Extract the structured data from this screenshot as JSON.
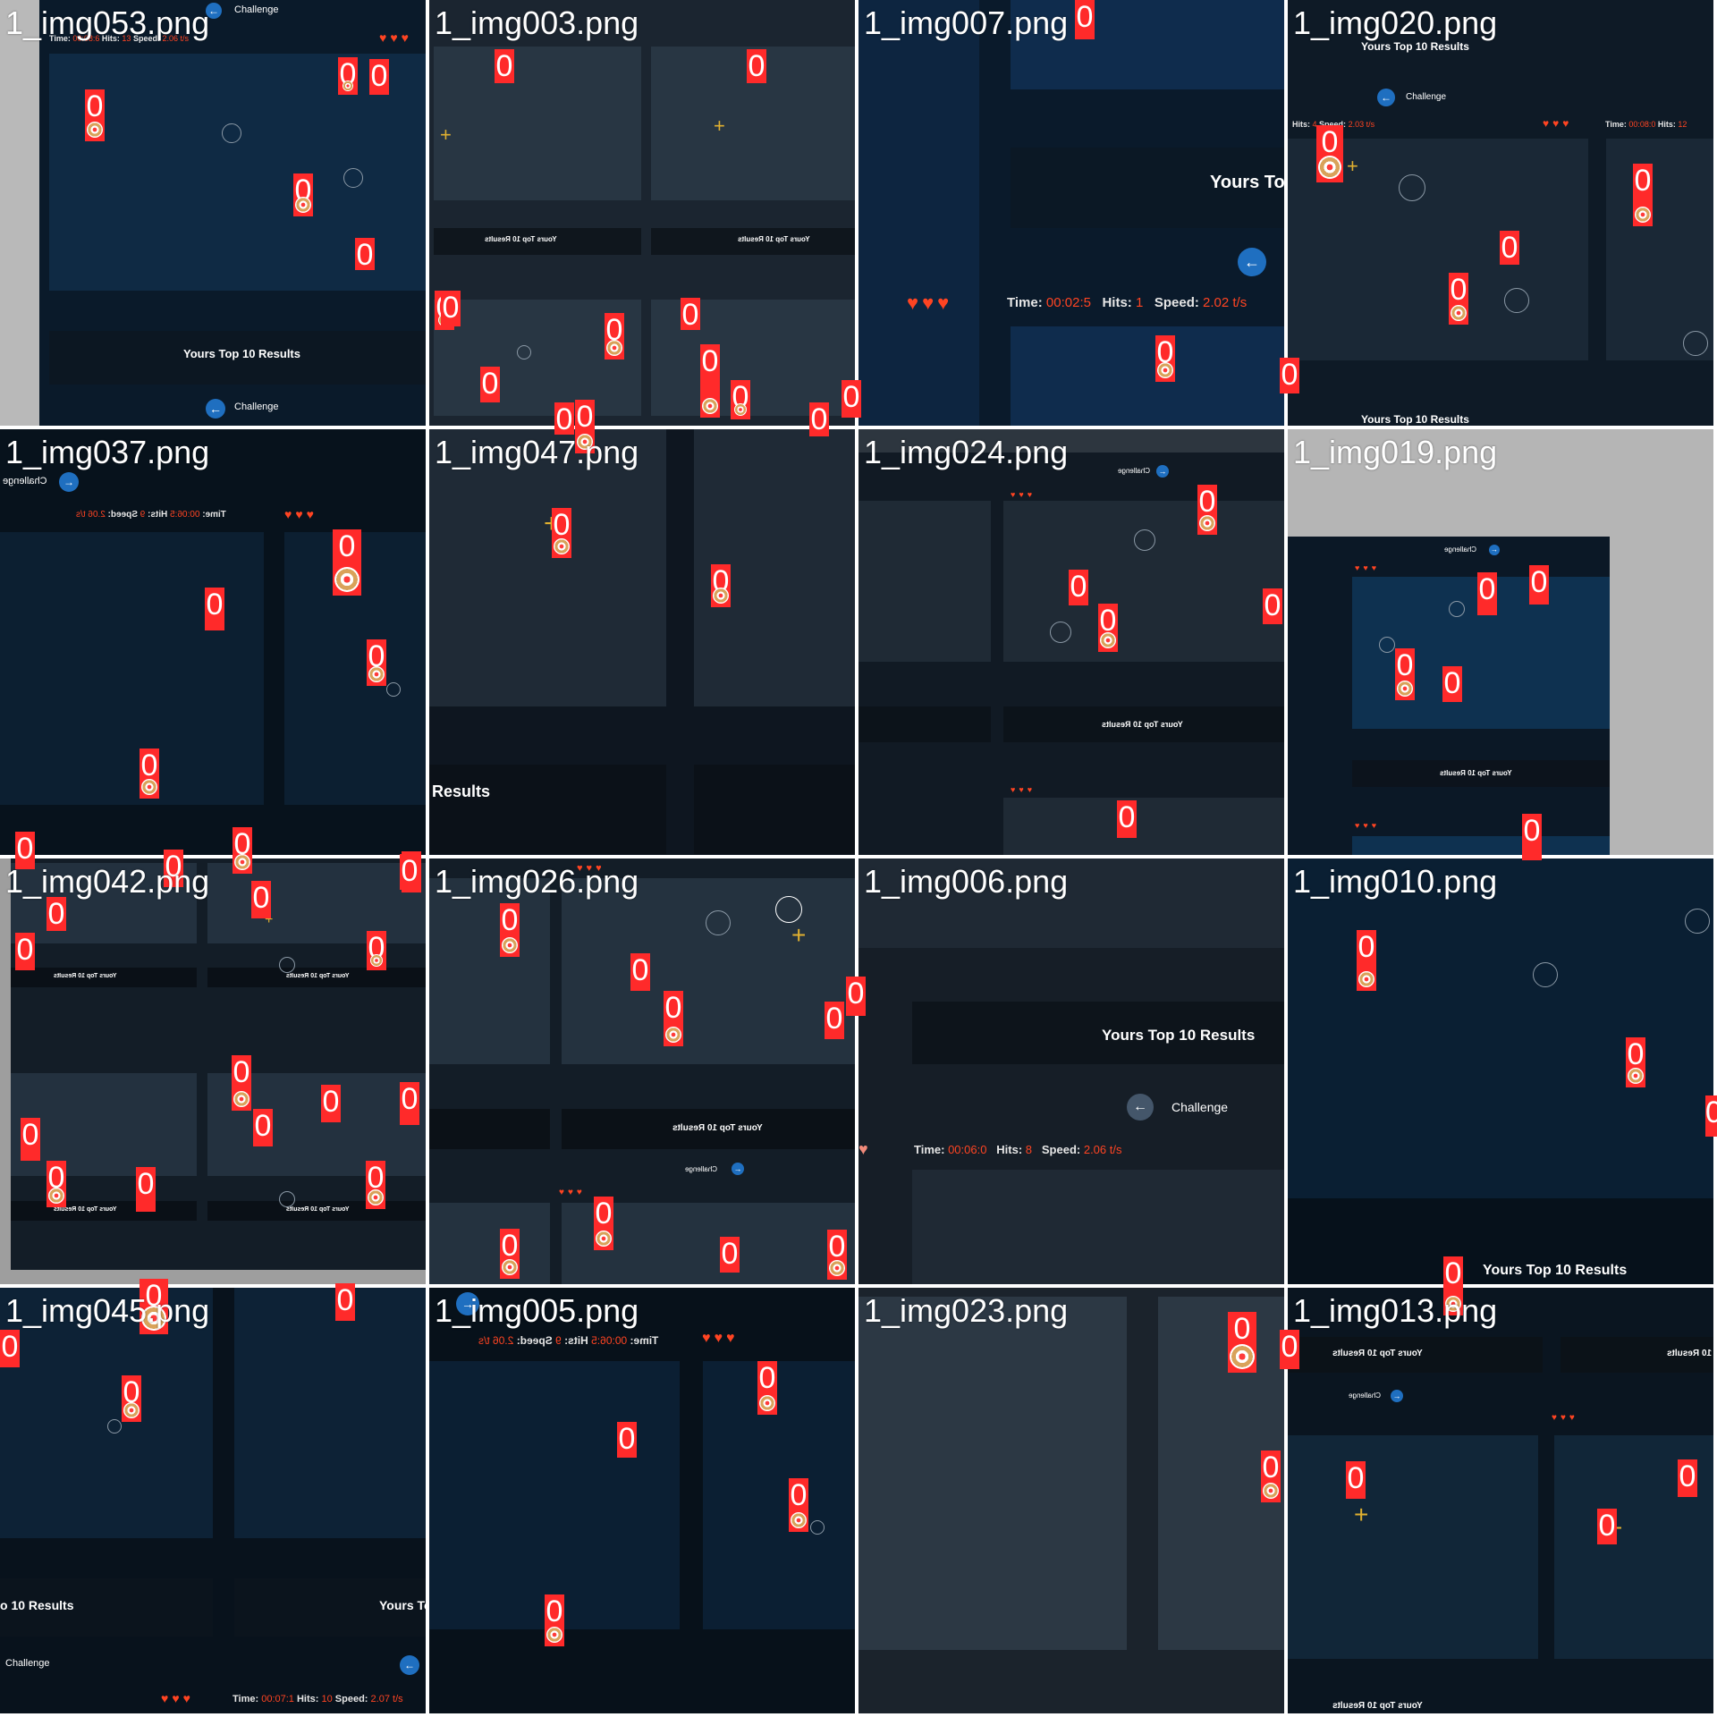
{
  "tiles": [
    {
      "name": "1_img053.png"
    },
    {
      "name": "1_img003.png"
    },
    {
      "name": "1_img007.png"
    },
    {
      "name": "1_img020.png"
    },
    {
      "name": "1_img037.png"
    },
    {
      "name": "1_img047.png"
    },
    {
      "name": "1_img024.png"
    },
    {
      "name": "1_img019.png"
    },
    {
      "name": "1_img042.png"
    },
    {
      "name": "1_img026.png"
    },
    {
      "name": "1_img006.png"
    },
    {
      "name": "1_img010.png"
    },
    {
      "name": "1_img045.png"
    },
    {
      "name": "1_img005.png"
    },
    {
      "name": "1_img023.png"
    },
    {
      "name": "1_img013.png"
    }
  ],
  "detection_label": "0",
  "ui": {
    "results_title": "Yours Top 10 Results",
    "results_short": "Results",
    "results_partial": "Yours Top",
    "results_partial_left": "o 10 Results",
    "challenge": "Challenge",
    "time_label": "Time:",
    "hits_label": "Hits:",
    "speed_label": "Speed:",
    "hearts": "♥♥♥"
  },
  "stats": {
    "img007": {
      "time": "00:02:5",
      "hits": "1",
      "speed": "2.02 t/s"
    },
    "img006": {
      "time": "00:06:0",
      "hits": "8",
      "speed": "2.06 t/s"
    },
    "img045": {
      "time": "00:07:1",
      "hits": "10",
      "speed": "2.07 t/s"
    },
    "img053": {
      "time": "00:08:6",
      "hits": "13",
      "speed": "2.06 t/s"
    },
    "img020": {
      "time": "00:08:0",
      "hits": "12",
      "speed": "2.03 t/s"
    },
    "img037": {
      "time": "00:06:5",
      "hits": "9",
      "speed": "2.06 t/s"
    },
    "img005": {
      "time": "00:06:5",
      "hits": "9",
      "speed": "2.06 t/s"
    }
  },
  "colors": {
    "detection_box": "#ff2a2a",
    "accent_value": "#ff4422",
    "button_blue": "#1f6fc0",
    "page_bg": "#ffffff"
  }
}
